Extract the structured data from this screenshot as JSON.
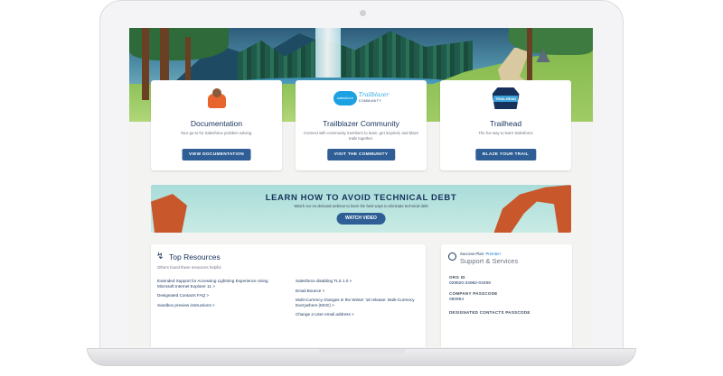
{
  "cards": [
    {
      "title": "Documentation",
      "description": "Your go-to for Salesforce problem solving.",
      "button": "VIEW DOCUMENTATION"
    },
    {
      "title": "Trailblazer Community",
      "description": "Connect with community members to learn, get inspired, and blaze trails together.",
      "button": "VISIT THE COMMUNITY",
      "logo_cloud_text": "salesforce",
      "logo_brand": "Trailblazer",
      "logo_sub": "COMMUNITY"
    },
    {
      "title": "Trailhead",
      "description": "The fun way to learn Salesforce",
      "button": "BLAZE YOUR TRAIL",
      "logo_text": "TRAILHEAD"
    }
  ],
  "banner": {
    "title": "LEARN HOW TO AVOID TECHNICAL DEBT",
    "description": "Watch our on demand webinar to learn the best ways to eliminate technical debt",
    "button": "WATCH VIDEO"
  },
  "top_resources": {
    "title": "Top Resources",
    "subtitle": "Others found these resources helpful",
    "left_links": [
      "Extended Support for Accessing Lightning Experience Using Microsoft Internet Explorer 11 >",
      "Designated Contacts FAQ >",
      "Sandbox preview instructions >"
    ],
    "right_links": [
      "Salesforce disabling TLS 1.0 >",
      "Email Bounce >",
      "Multi-Currency changes in the Winter '18 release: Multi-Currency Everywhere (MCE) >",
      "Change a User email address >"
    ]
  },
  "support": {
    "plan_label": "Success Plan:",
    "plan_name": "Premier+",
    "title": "Support & Services",
    "org_id_label": "ORG ID",
    "org_id": "029820-34982-03498",
    "company_passcode_label": "COMPANY PASSCODE",
    "company_passcode": "090994",
    "designated_passcode_label": "DESIGNATED CONTACTS PASSCODE"
  },
  "colors": {
    "accent": "#2e5e95",
    "heading": "#16325c",
    "brand_blue": "#1ba1e2"
  }
}
